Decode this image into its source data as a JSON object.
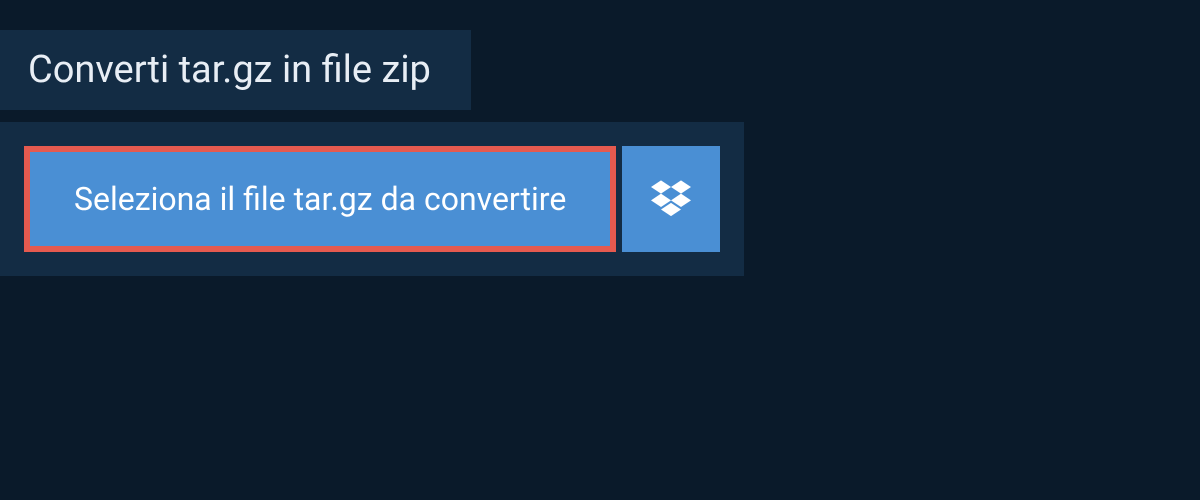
{
  "header": {
    "title": "Converti tar.gz in file zip"
  },
  "upload": {
    "select_label": "Seleziona il file tar.gz da convertire",
    "dropbox_icon": "dropbox-icon"
  },
  "colors": {
    "panel_bg": "#132c44",
    "page_bg": "#0a1a2a",
    "button_bg": "#4a8fd4",
    "highlight_border": "#e55a4f",
    "text_light": "#ffffff"
  }
}
